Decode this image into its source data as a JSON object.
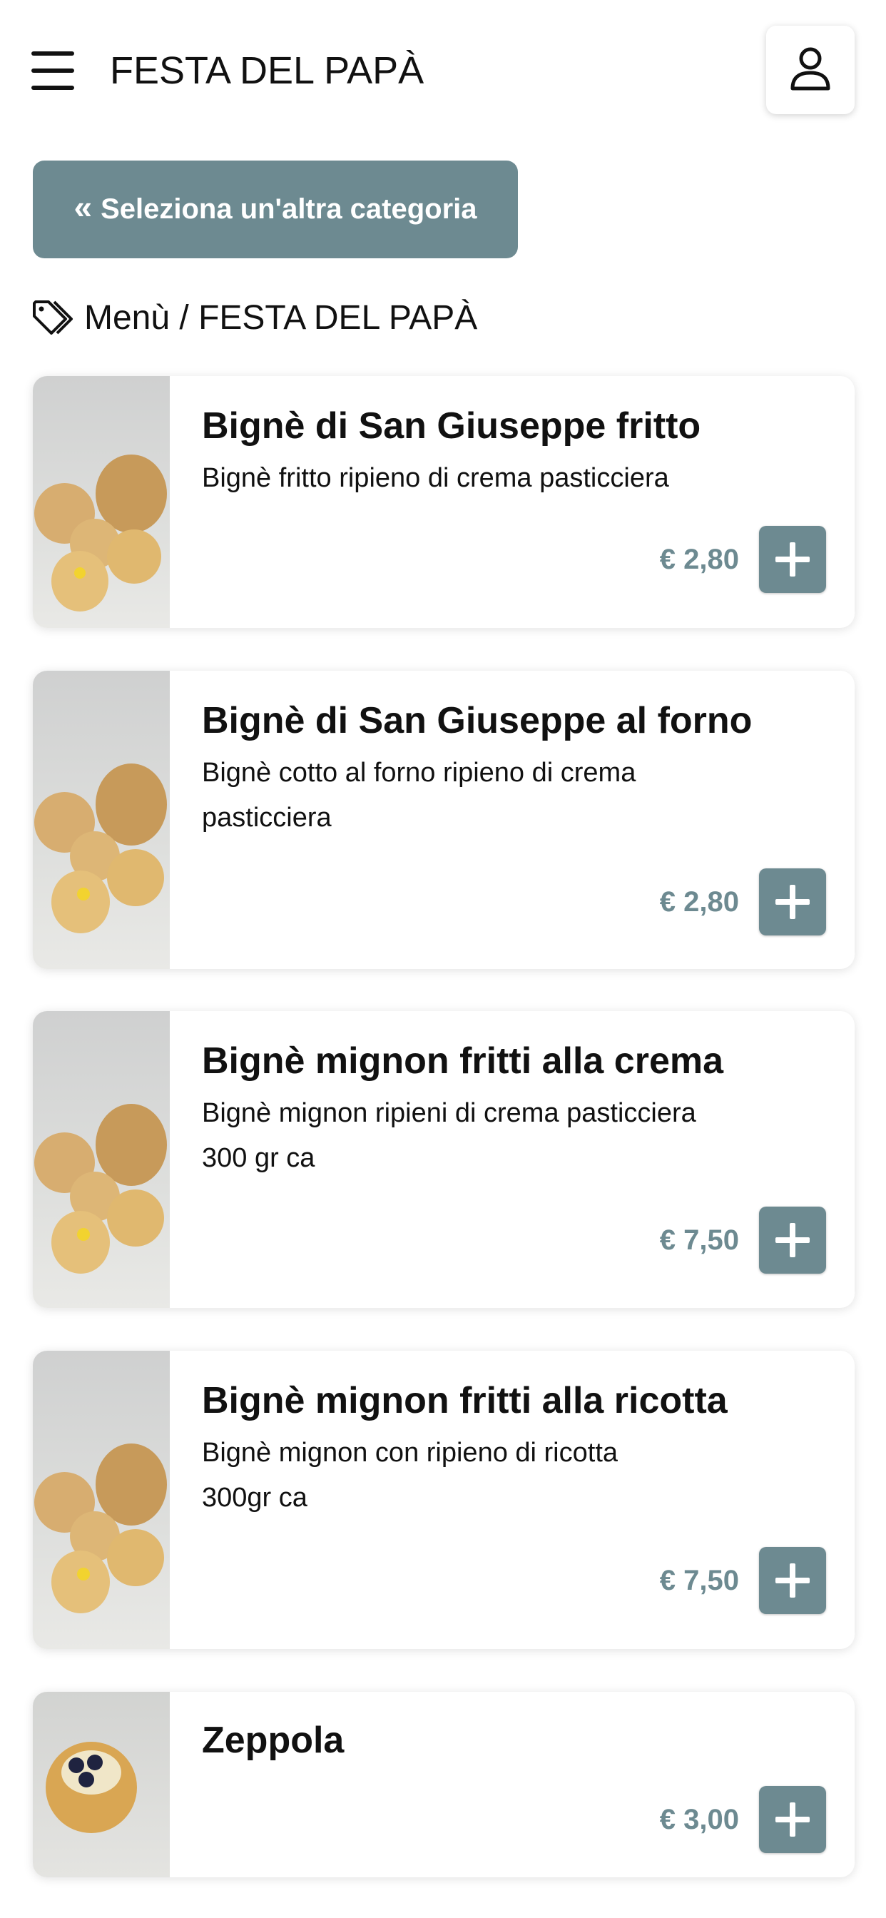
{
  "header": {
    "menu_icon": "hamburger-menu-icon",
    "title": "FESTA DEL PAPÀ",
    "user_icon": "user-icon"
  },
  "category_button": {
    "icon": "double-chevron-left-icon",
    "chevron": "«",
    "label": "Seleziona un'altra categoria"
  },
  "breadcrumb": {
    "icon": "tag-icon",
    "text": "Menù / FESTA DEL PAPÀ"
  },
  "products": [
    {
      "name": "Bignè di San Giuseppe fritto",
      "description": "Bignè fritto ripieno di crema pasticciera",
      "price": "€ 2,80"
    },
    {
      "name": "Bignè di San Giuseppe al forno",
      "description": "Bignè cotto al forno ripieno di crema\npasticciera",
      "price": "€ 2,80"
    },
    {
      "name": "Bignè mignon fritti alla crema",
      "description": "Bignè mignon ripieni di crema pasticciera\n300 gr ca",
      "price": "€ 7,50"
    },
    {
      "name": "Bignè mignon fritti alla ricotta",
      "description": "Bignè mignon con ripieno di ricotta\n300gr ca",
      "price": "€ 7,50"
    },
    {
      "name": "Zeppola",
      "description": "",
      "price": "€ 3,00"
    }
  ],
  "colors": {
    "accent": "#6d8a91",
    "text": "#111111",
    "background": "#ffffff"
  }
}
